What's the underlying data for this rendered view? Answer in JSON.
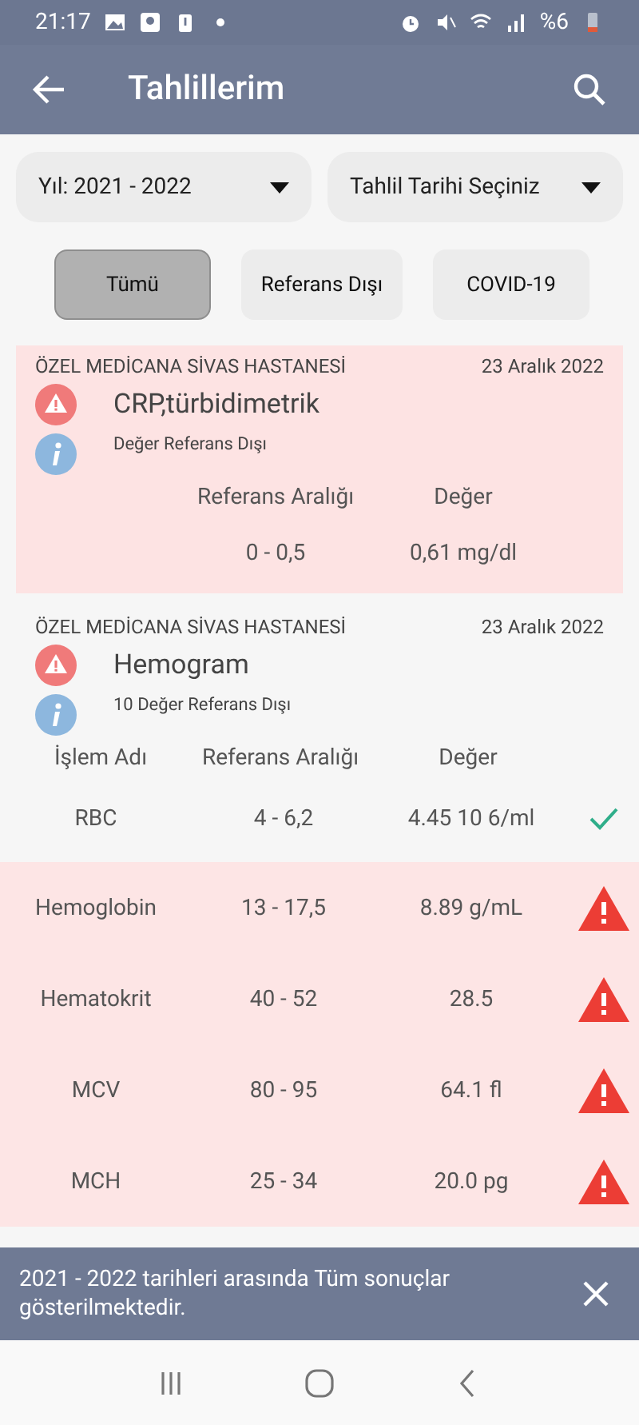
{
  "status_bar": {
    "time": "21:17",
    "battery": "%6"
  },
  "app_bar": {
    "title": "Tahlillerim"
  },
  "filters": {
    "year": "Yıl: 2021 - 2022",
    "date": "Tahlil Tarihi Seçiniz"
  },
  "tabs": [
    {
      "label": "Tümü",
      "selected": true
    },
    {
      "label": "Referans Dışı",
      "selected": false
    },
    {
      "label": "COVID-19",
      "selected": false
    }
  ],
  "results": [
    {
      "hospital": "ÖZEL MEDİCANA SİVAS HASTANESİ",
      "date": "23 Aralık 2022",
      "title": "CRP,türbidimetrik",
      "note": "Değer Referans Dışı",
      "out_of_range": true,
      "columns": [
        "Referans Aralığı",
        "Değer"
      ],
      "rows": [
        {
          "range": "0 - 0,5",
          "value": "0,61 mg/dl"
        }
      ]
    },
    {
      "hospital": "ÖZEL MEDİCANA SİVAS HASTANESİ",
      "date": "23 Aralık 2022",
      "title": "Hemogram",
      "note": "10 Değer Referans Dışı",
      "out_of_range": false,
      "columns": [
        "İşlem Adı",
        "Referans Aralığı",
        "Değer"
      ],
      "rows": [
        {
          "name": "RBC",
          "range": "4 - 6,2",
          "value": "4.45 10 6/ml",
          "out_of_range": false
        },
        {
          "name": "Hemoglobin",
          "range": "13 - 17,5",
          "value": "8.89 g/mL",
          "out_of_range": true
        },
        {
          "name": "Hematokrit",
          "range": "40 - 52",
          "value": "28.5",
          "out_of_range": true
        },
        {
          "name": "MCV",
          "range": "80 - 95",
          "value": "64.1 fl",
          "out_of_range": true
        },
        {
          "name": "MCH",
          "range": "25 - 34",
          "value": "20.0 pg",
          "out_of_range": true
        }
      ]
    }
  ],
  "toast": {
    "message": "2021 - 2022 tarihleri arasında Tüm sonuçlar gösterilmektedir."
  }
}
